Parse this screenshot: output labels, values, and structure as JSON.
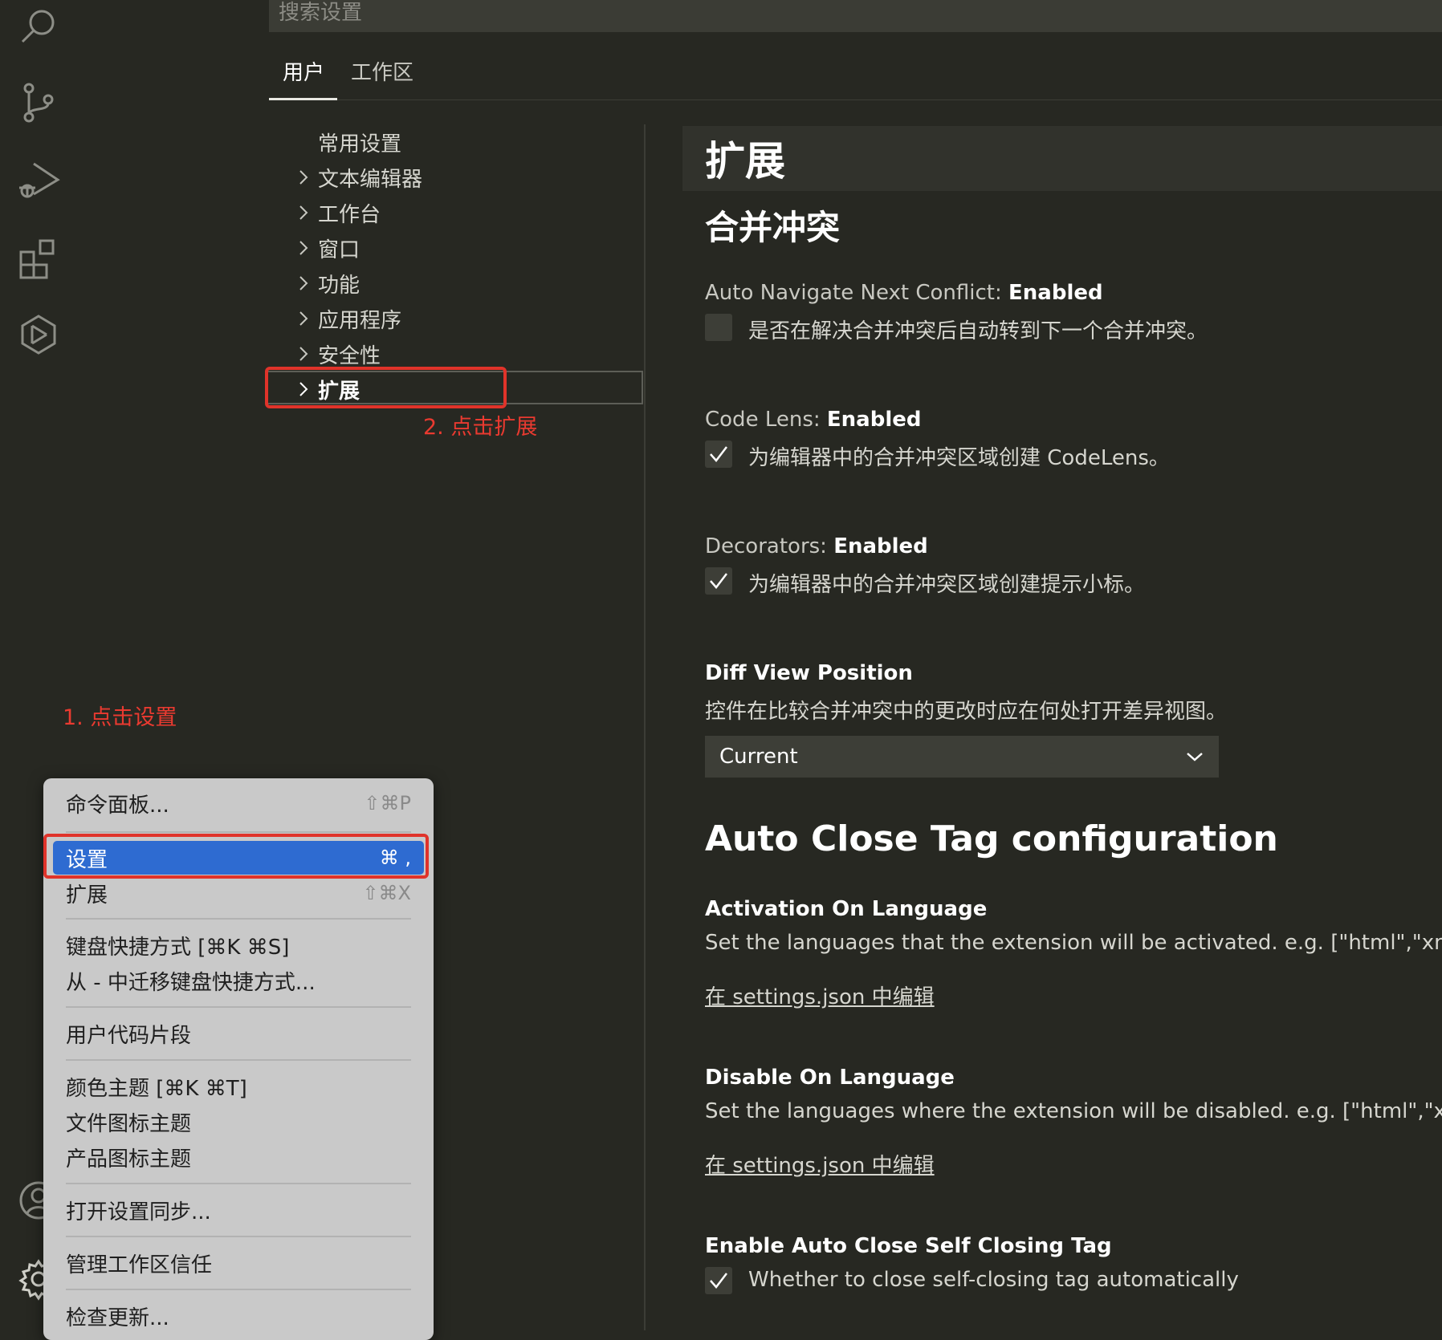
{
  "activity_bar": {
    "icons": [
      "search-icon",
      "source-control-icon",
      "run-debug-icon",
      "extensions-icon",
      "remote-explorer-icon",
      "account-icon",
      "gear-icon"
    ]
  },
  "search": {
    "placeholder": "搜索设置"
  },
  "tabs": [
    {
      "label": "用户",
      "active": true
    },
    {
      "label": "工作区",
      "active": false
    }
  ],
  "toc": {
    "items": [
      {
        "label": "常用设置",
        "expandable": false
      },
      {
        "label": "文本编辑器",
        "expandable": true
      },
      {
        "label": "工作台",
        "expandable": true
      },
      {
        "label": "窗口",
        "expandable": true
      },
      {
        "label": "功能",
        "expandable": true
      },
      {
        "label": "应用程序",
        "expandable": true
      },
      {
        "label": "安全性",
        "expandable": true
      },
      {
        "label": "扩展",
        "expandable": true,
        "selected": true
      }
    ]
  },
  "annotations": {
    "step1": "1. 点击设置",
    "step2": "2. 点击扩展",
    "color": "#e0332a"
  },
  "content": {
    "section_title": "扩展",
    "merge_conflict": {
      "title": "合并冲突",
      "settings": [
        {
          "name": "Auto Navigate Next Conflict: ",
          "name_bold": "Enabled",
          "description": "是否在解决合并冲突后自动转到下一个合并冲突。",
          "checked": false
        },
        {
          "name": "Code Lens: ",
          "name_bold": "Enabled",
          "description": "为编辑器中的合并冲突区域创建 CodeLens。",
          "checked": true
        },
        {
          "name": "Decorators: ",
          "name_bold": "Enabled",
          "description": "为编辑器中的合并冲突区域创建提示小标。",
          "checked": true
        }
      ],
      "diff_view": {
        "name_bold": "Diff View Position",
        "description": "控件在比较合并冲突中的更改时应在何处打开差异视图。",
        "selected": "Current"
      }
    },
    "auto_close_tag": {
      "title": "Auto Close Tag configuration",
      "activation": {
        "name_bold": "Activation On Language",
        "description": "Set the languages that the extension will be activated.  e.g. [\"html\",\"xml\",\"ph",
        "link": "在 settings.json 中编辑"
      },
      "disable": {
        "name_bold": "Disable On Language",
        "description": "Set the languages where the extension will be disabled.  e.g. [\"html\",\"xml\",\"p",
        "link": "在 settings.json 中编辑"
      },
      "self_closing": {
        "name_bold": "Enable Auto Close Self Closing Tag",
        "description": "Whether to close self-closing tag automatically",
        "checked": true
      }
    }
  },
  "menu": {
    "items": [
      {
        "label": "命令面板...",
        "shortcut": "⇧⌘P"
      },
      {
        "label": "设置",
        "shortcut": "⌘ ,",
        "active": true
      },
      {
        "label": "扩展",
        "shortcut": "⇧⌘X"
      },
      {
        "label": "键盘快捷方式 [⌘K ⌘S]",
        "shortcut": ""
      },
      {
        "label": "从 - 中迁移键盘快捷方式...",
        "shortcut": ""
      },
      {
        "label": "用户代码片段",
        "shortcut": ""
      },
      {
        "label": "颜色主题 [⌘K ⌘T]",
        "shortcut": ""
      },
      {
        "label": "文件图标主题",
        "shortcut": ""
      },
      {
        "label": "产品图标主题",
        "shortcut": ""
      },
      {
        "label": "打开设置同步...",
        "shortcut": ""
      },
      {
        "label": "管理工作区信任",
        "shortcut": ""
      },
      {
        "label": "检查更新...",
        "shortcut": ""
      }
    ]
  }
}
